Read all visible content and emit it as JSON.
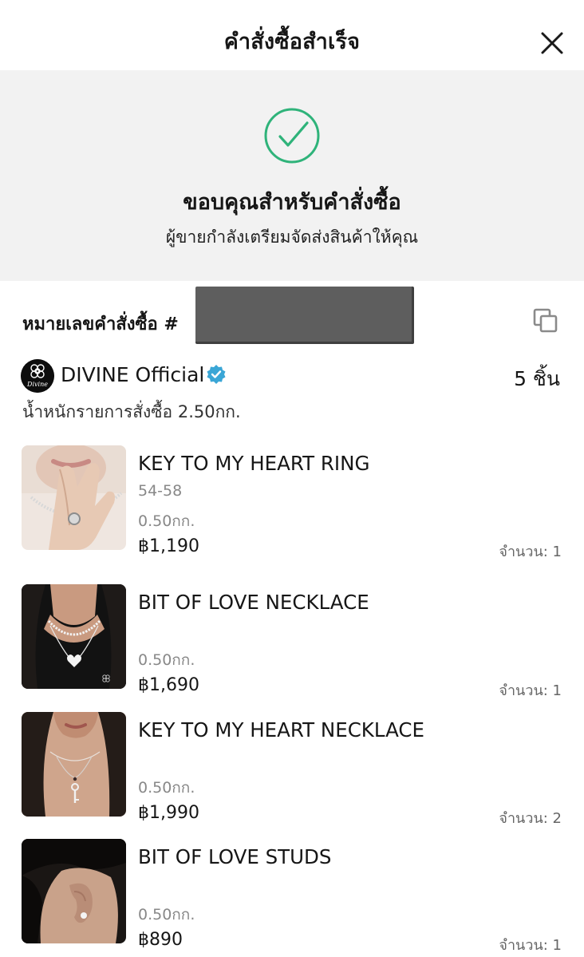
{
  "header": {
    "title": "คำสั่งซื้อสำเร็จ",
    "close_icon": "close-icon"
  },
  "success": {
    "icon": "check-circle-icon",
    "accent_color": "#2fb37a",
    "title": "ขอบคุณสำหรับคำสั่งซื้อ",
    "subtitle": "ผู้ขายกำลังเตรียมจัดส่งสินค้าให้คุณ"
  },
  "order": {
    "label": "หมายเลขคำสั่งซื้อ #",
    "copy_icon": "copy-icon"
  },
  "shop": {
    "name": "DIVINE Official",
    "logo_text": "Divine",
    "verified_color": "#3aa6d6",
    "item_count": "5 ชิ้น",
    "weight_line": "น้ำหนักรายการสั่งซื้อ 2.50กก."
  },
  "products": [
    {
      "name": "KEY TO MY HEART RING",
      "variant": "54-58",
      "weight": "0.50กก.",
      "price": "฿1,190",
      "qty": "จำนวน: 1"
    },
    {
      "name": "BIT OF LOVE NECKLACE",
      "variant": "",
      "weight": "0.50กก.",
      "price": "฿1,690",
      "qty": "จำนวน: 1"
    },
    {
      "name": "KEY TO MY HEART NECKLACE",
      "variant": "",
      "weight": "0.50กก.",
      "price": "฿1,990",
      "qty": "จำนวน: 2"
    },
    {
      "name": "BIT OF LOVE STUDS",
      "variant": "",
      "weight": "0.50กก.",
      "price": "฿890",
      "qty": "จำนวน: 1"
    }
  ]
}
